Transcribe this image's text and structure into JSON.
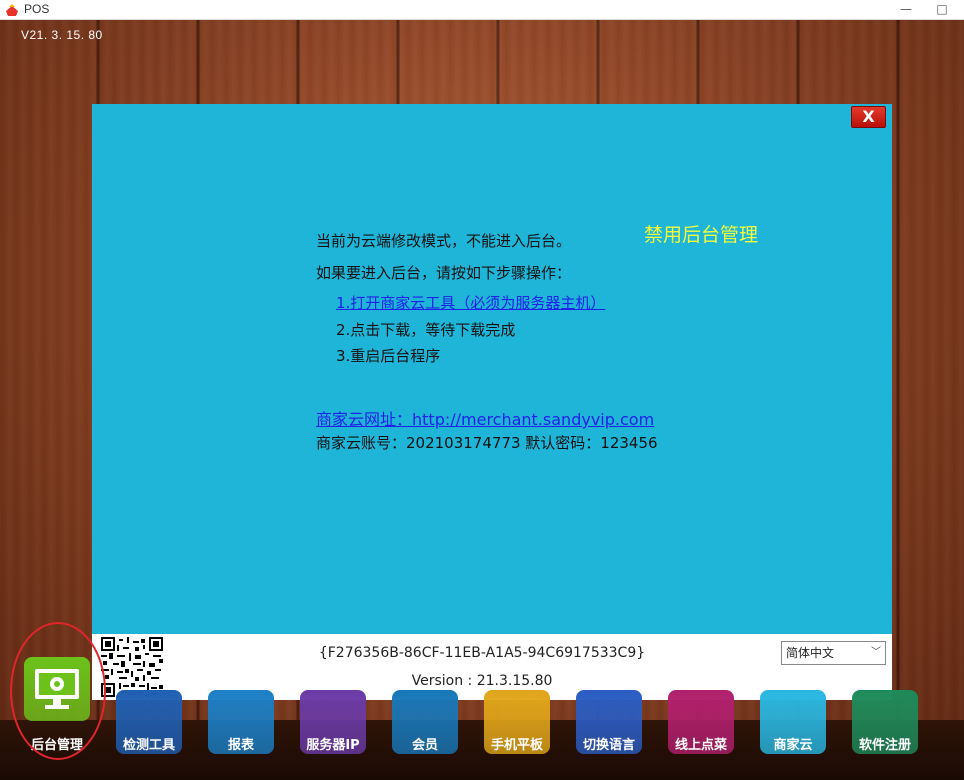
{
  "window": {
    "title": "POS",
    "minimize": "—",
    "maximize": "□"
  },
  "desktop": {
    "version": "V21. 3. 15. 80"
  },
  "dialog": {
    "close": "X",
    "heading": "禁用后台管理",
    "line1": "当前为云端修改模式，不能进入后台。",
    "line2": "如果要进入后台，请按如下步骤操作：",
    "steps": [
      "1.打开商家云工具（必须为服务器主机）",
      "2.点击下载，等待下载完成",
      "3.重启后台程序"
    ],
    "url_text": "商家云网址：http://merchant.sandyvip.com",
    "account_text": "商家云账号：202103174773   默认密码：123456",
    "guid": "{F276356B-86CF-11EB-A1A5-94C6917533C9}",
    "version": "Version : 21.3.15.80",
    "language": {
      "selected": "简体中文",
      "arrow": "﹀"
    }
  },
  "toolbar": {
    "items": [
      {
        "label": "后台管理",
        "color": "#6cc21a"
      },
      {
        "label": "检测工具",
        "color": "#1f5fb2"
      },
      {
        "label": "报表",
        "color": "#1b7ec4"
      },
      {
        "label": "服务器IP",
        "color": "#6a3aa6"
      },
      {
        "label": "会员",
        "color": "#1877b8"
      },
      {
        "label": "手机平板",
        "color": "#e0a51a"
      },
      {
        "label": "切换语言",
        "color": "#2a5cc2"
      },
      {
        "label": "线上点菜",
        "color": "#b01f6c"
      },
      {
        "label": "商家云",
        "color": "#28b6e0"
      },
      {
        "label": "软件注册",
        "color": "#1e8a5a"
      }
    ]
  }
}
